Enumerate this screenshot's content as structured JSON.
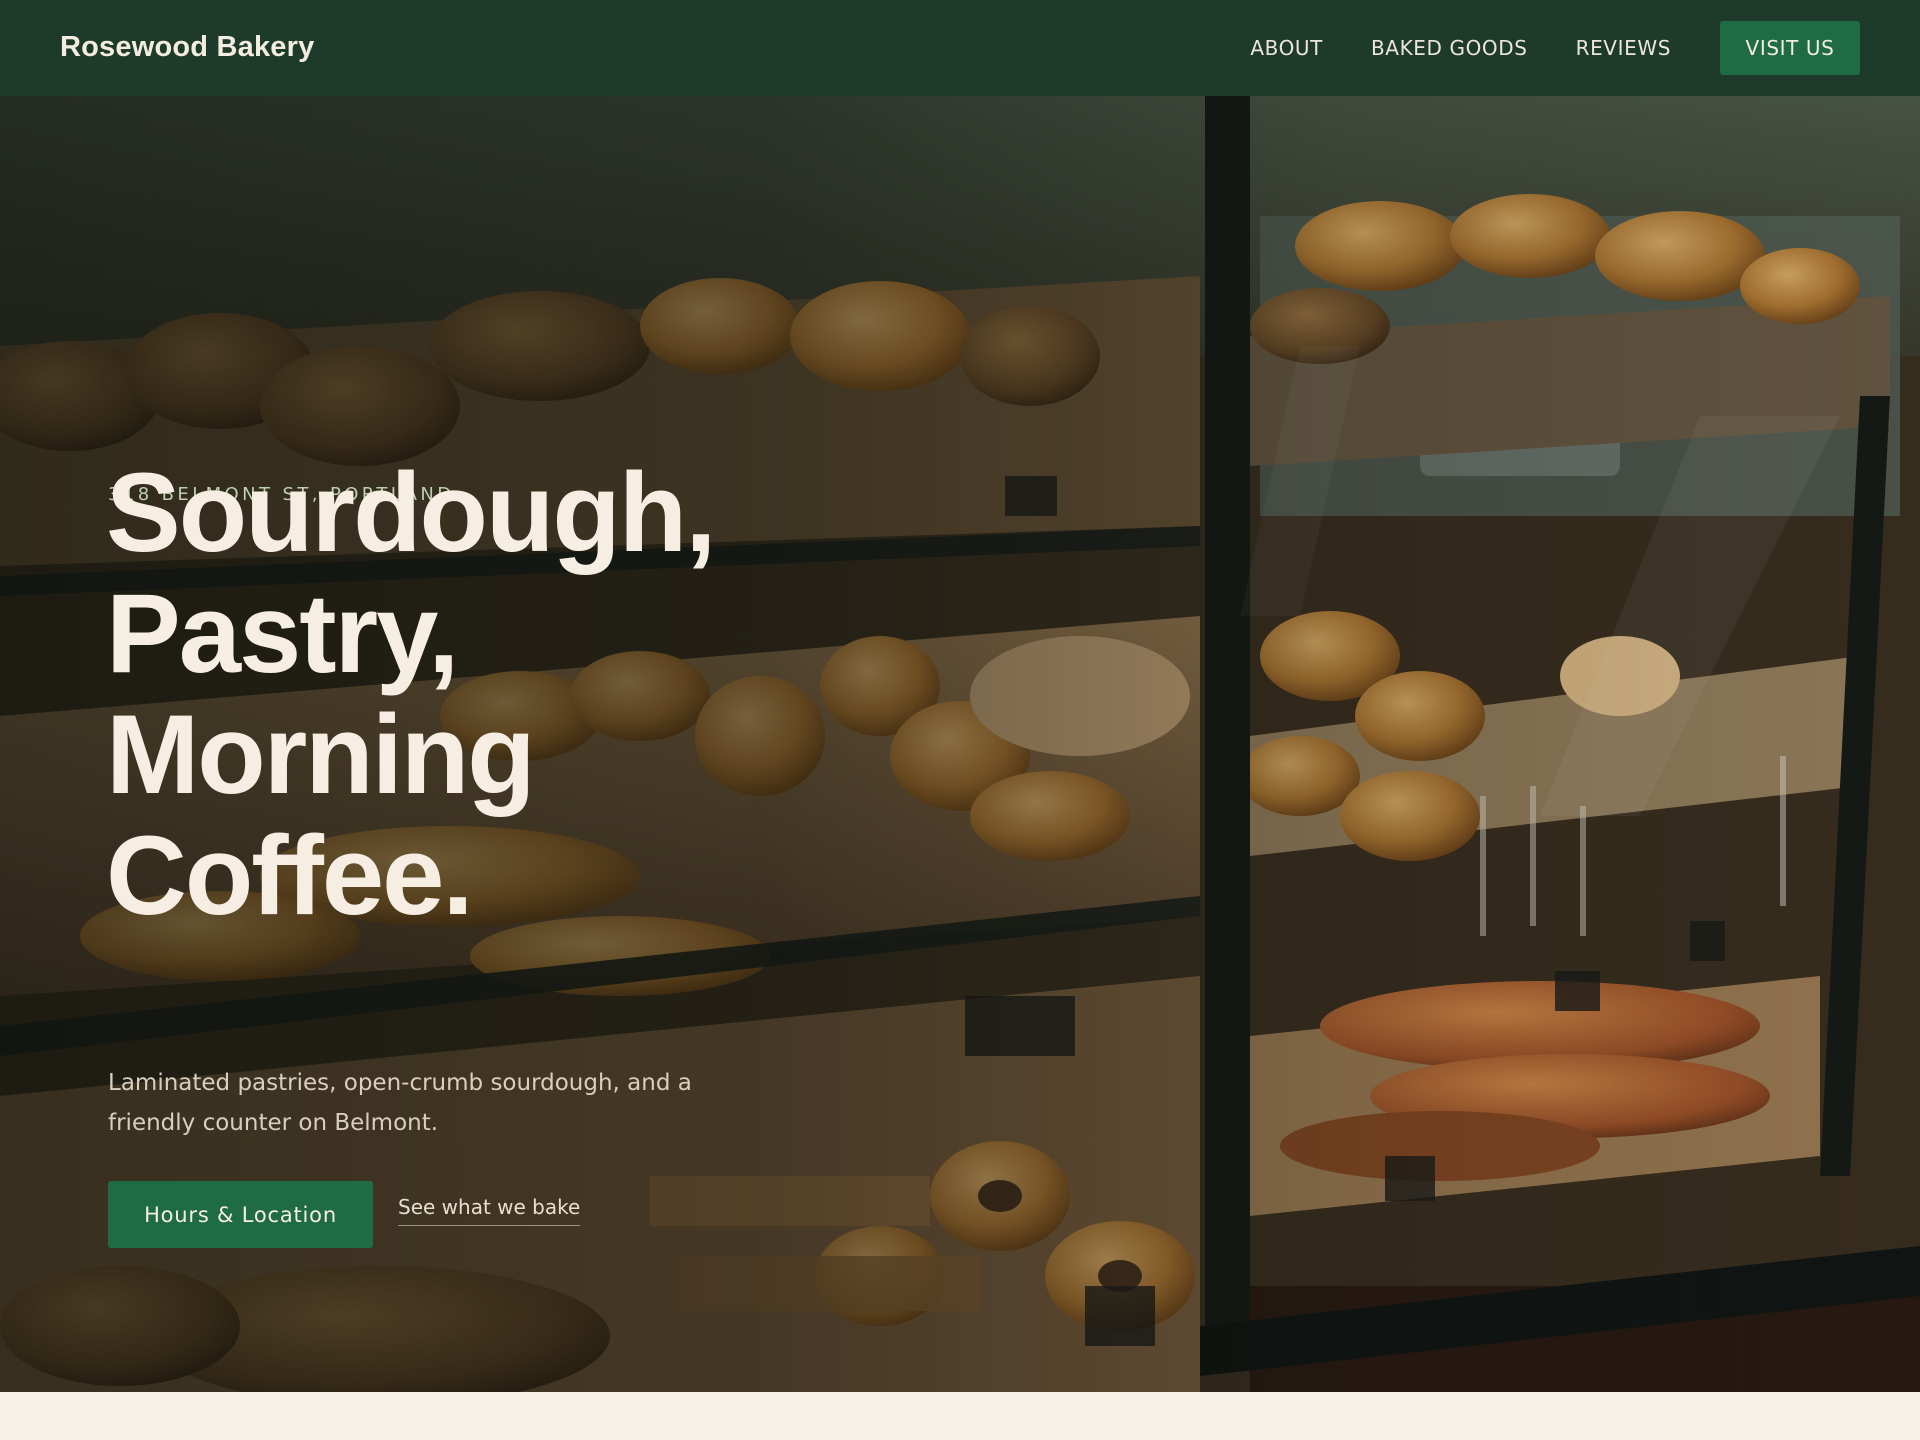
{
  "nav": {
    "brand": "Rosewood Bakery",
    "links": [
      "ABOUT",
      "BAKED GOODS",
      "REVIEWS"
    ],
    "cta_label": "VISIT US"
  },
  "hero": {
    "eyebrow": "318 BELMONT ST, PORTLAND",
    "headline_lines": [
      "Sourdough,",
      "Pastry,",
      "Morning",
      "Coffee."
    ],
    "subtext": "Laminated pastries, open-crumb sourdough, and a friendly counter on Belmont.",
    "primary_button_label": "Hours & Location",
    "secondary_link_label": "See what we bake",
    "background": "bakery display case with breads and pastries"
  },
  "colors": {
    "nav_background": "#1d3a2a",
    "accent_green": "#1f6b43",
    "cream": "#f5f0e8",
    "headline_text": "#f6eee2",
    "eyebrow_text": "#bcd0b0"
  }
}
